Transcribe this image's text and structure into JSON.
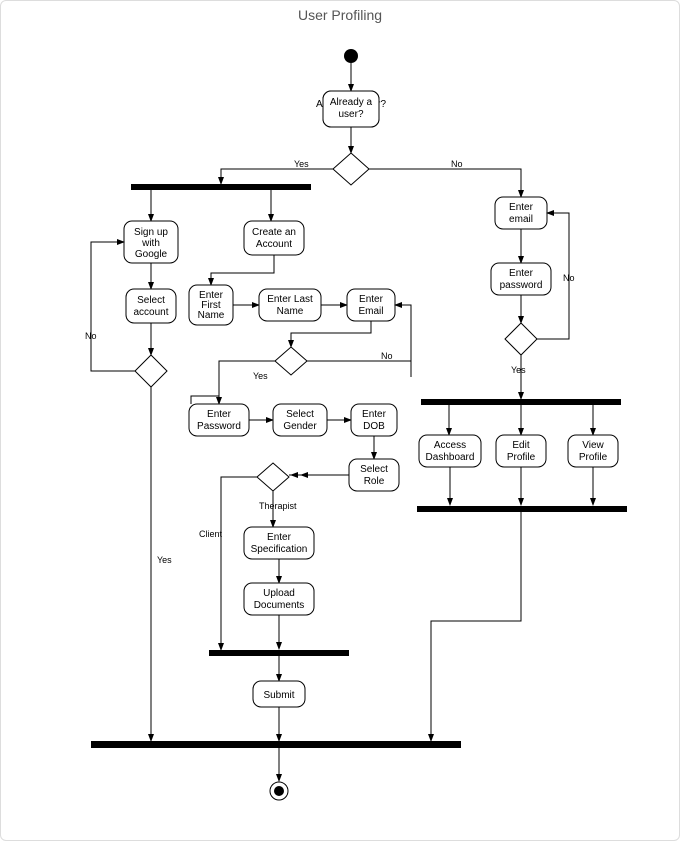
{
  "title": "User Profiling",
  "nodes": {
    "already_user": "Already a user?",
    "signup_google_1": "Sign up",
    "signup_google_2": "with",
    "signup_google_3": "Google",
    "create_account_1": "Create an",
    "create_account_2": "Account",
    "select_account_1": "Select",
    "select_account_2": "account",
    "enter_first_1": "Enter",
    "enter_first_2": "First",
    "enter_first_3": "Name",
    "enter_last_1": "Enter Last",
    "enter_last_2": "Name",
    "enter_email_left_1": "Enter",
    "enter_email_left_2": "Email",
    "enter_password_left_1": "Enter",
    "enter_password_left_2": "Password",
    "select_gender_1": "Select",
    "select_gender_2": "Gender",
    "enter_dob_1": "Enter",
    "enter_dob_2": "DOB",
    "select_role_1": "Select",
    "select_role_2": "Role",
    "enter_spec_1": "Enter",
    "enter_spec_2": "Specification",
    "upload_docs_1": "Upload",
    "upload_docs_2": "Documents",
    "submit": "Submit",
    "enter_email_r_1": "Enter",
    "enter_email_r_2": "email",
    "enter_password_r_1": "Enter",
    "enter_password_r_2": "password",
    "access_dash_1": "Access",
    "access_dash_2": "Dashboard",
    "edit_profile_1": "Edit",
    "edit_profile_2": "Profile",
    "view_profile_1": "View",
    "view_profile_2": "Profile"
  },
  "labels": {
    "yes": "Yes",
    "no": "No",
    "therapist": "Therapist",
    "client": "Client"
  }
}
